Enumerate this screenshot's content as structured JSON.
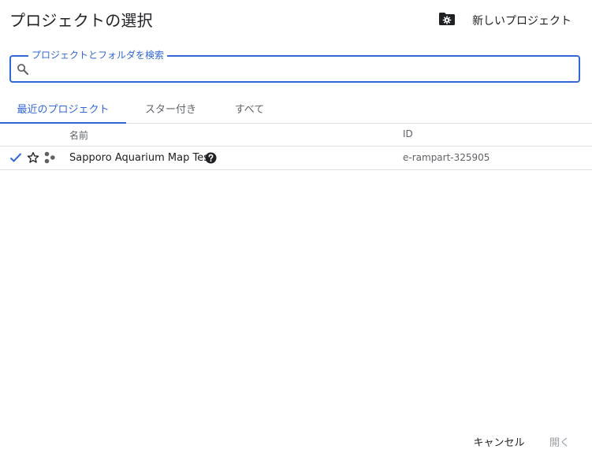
{
  "dialog": {
    "title": "プロジェクトの選択",
    "new_project_label": "新しいプロジェクト"
  },
  "search": {
    "label": "プロジェクトとフォルダを検索",
    "value": "",
    "placeholder": ""
  },
  "tabs": [
    {
      "label": "最近のプロジェクト",
      "active": true
    },
    {
      "label": "スター付き",
      "active": false
    },
    {
      "label": "すべて",
      "active": false
    }
  ],
  "table": {
    "columns": {
      "name": "名前",
      "id": "ID"
    },
    "rows": [
      {
        "selected": true,
        "starred": false,
        "name": "Sapporo Aquarium Map Test",
        "id": "e-rampart-325905"
      }
    ]
  },
  "buttons": {
    "cancel": "キャンセル",
    "open": "開く"
  },
  "colors": {
    "accent": "#3367d6",
    "text": "#202124",
    "muted": "#5f6368",
    "disabled": "#9aa0a6",
    "divider": "#e0e0e0"
  },
  "icons": {
    "new_project": "folder-gear-icon",
    "search": "search-icon",
    "check": "check-icon",
    "star": "star-outline-icon",
    "project": "project-dots-icon",
    "help": "help-circle-icon"
  }
}
